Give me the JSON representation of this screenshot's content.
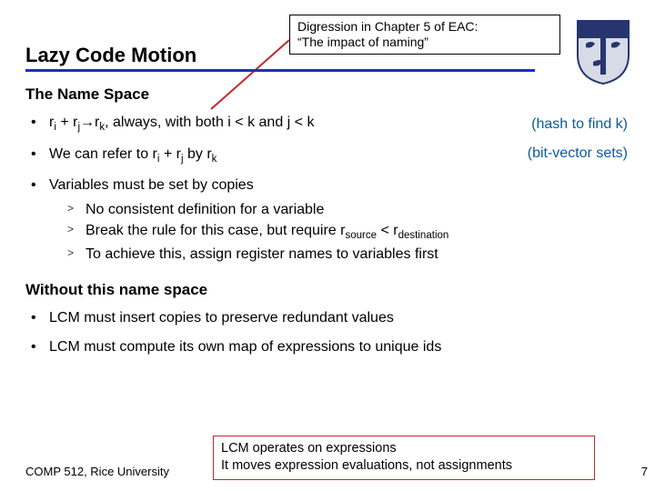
{
  "header": {
    "title": "Lazy Code Motion",
    "callout_line1": "Digression in Chapter 5 of EAC:",
    "callout_line2": "“The impact of naming”"
  },
  "subhead": "The Name Space",
  "bullets": {
    "b1_pre": "r",
    "b1_i": "i",
    "b1_plus": " + r",
    "b1_j": "j",
    "b1_arrow": "→r",
    "b1_k": "k",
    "b1_rest": ", always, with both i < k and j < k",
    "b1_aside": "(hash to find k)",
    "b2_pre": "We can refer to r",
    "b2_i": "i",
    "b2_mid": " + r",
    "b2_j": "j",
    "b2_mid2": " by r",
    "b2_k": "k",
    "b2_aside": "(bit-vector sets)",
    "b3": "Variables must be set by copies",
    "b3_s1": "No consistent definition for a variable",
    "b3_s2_pre": "Break the rule for this case, but require r",
    "b3_s2_src": "source",
    "b3_s2_mid": " < r",
    "b3_s2_dst": "destination",
    "b3_s3": "To achieve this, assign register names to variables first"
  },
  "section2": "Without this name space",
  "bullets2": {
    "c1": "LCM must insert copies to preserve redundant values",
    "c2": "LCM must compute its own map of expressions to unique ids"
  },
  "bottom": {
    "l1": "LCM operates on expressions",
    "l2": "It moves expression evaluations, not assignments"
  },
  "footer": {
    "left": "COMP 512, Rice University",
    "right": "7"
  }
}
